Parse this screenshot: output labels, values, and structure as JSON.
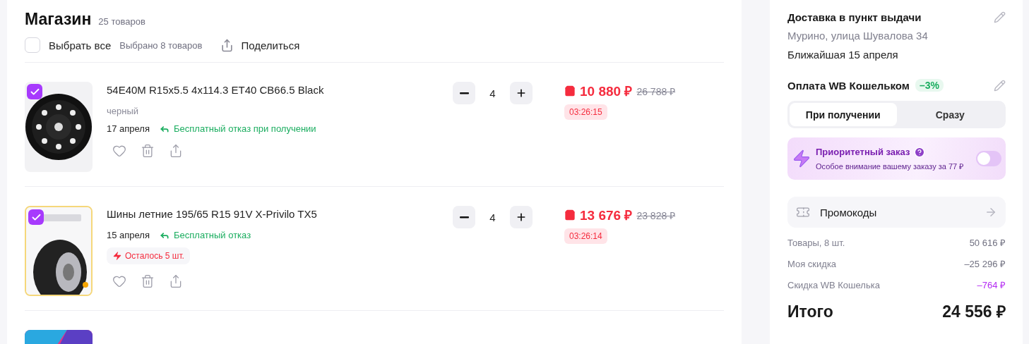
{
  "shop": {
    "title": "Магазин",
    "count": "25 товаров",
    "select_all": {
      "label": "Выбрать все",
      "checked": false
    },
    "selected_count": "Выбрано 8 товаров",
    "share": "Поделиться"
  },
  "items": [
    {
      "kind": "wheel",
      "checked": true,
      "framed": false,
      "title": "54E40M R15x5.5 4x114.3 ET40 CB66.5 Black",
      "variant": "черный",
      "date": "17 апреля",
      "refund": "Бесплатный отказ при получении",
      "quantity": "4",
      "price": "10 880 ₽",
      "old_price": "26 788 ₽",
      "timer": "03:26:15"
    },
    {
      "kind": "tyre",
      "checked": true,
      "framed": true,
      "title": "Шины летние 195/65 R15 91V X-Privilo TX5",
      "date": "15 апреля",
      "refund": "Бесплатный отказ",
      "stock": "Осталось 5 шт.",
      "quantity": "4",
      "price": "13 676 ₽",
      "old_price": "23 828 ₽",
      "timer": "03:26:14"
    }
  ],
  "delivery": {
    "title": "Доставка в пункт выдачи",
    "address": "Мурино, улица Шувалова 34",
    "nearest": "Ближайшая 15 апреля"
  },
  "payment": {
    "title": "Оплата WB Кошельком",
    "badge": "–3%",
    "options": [
      {
        "label": "При получении",
        "selected": true
      },
      {
        "label": "Сразу",
        "selected": false
      }
    ]
  },
  "priority": {
    "title": "Приоритетный заказ",
    "hint": "Особое внимание вашему заказу за 77 ₽",
    "on": false
  },
  "promo": "Промокоды",
  "summary": [
    {
      "kind": "plain",
      "label": "Товары, 8 шт.",
      "value": "50 616 ₽"
    },
    {
      "kind": "plain",
      "label": "Моя скидка",
      "value": "–25 296 ₽"
    },
    {
      "kind": "wallet",
      "label": "Скидка WB Кошелька",
      "value": "–764 ₽"
    }
  ],
  "total": {
    "label": "Итого",
    "value": "24 556 ₽"
  }
}
